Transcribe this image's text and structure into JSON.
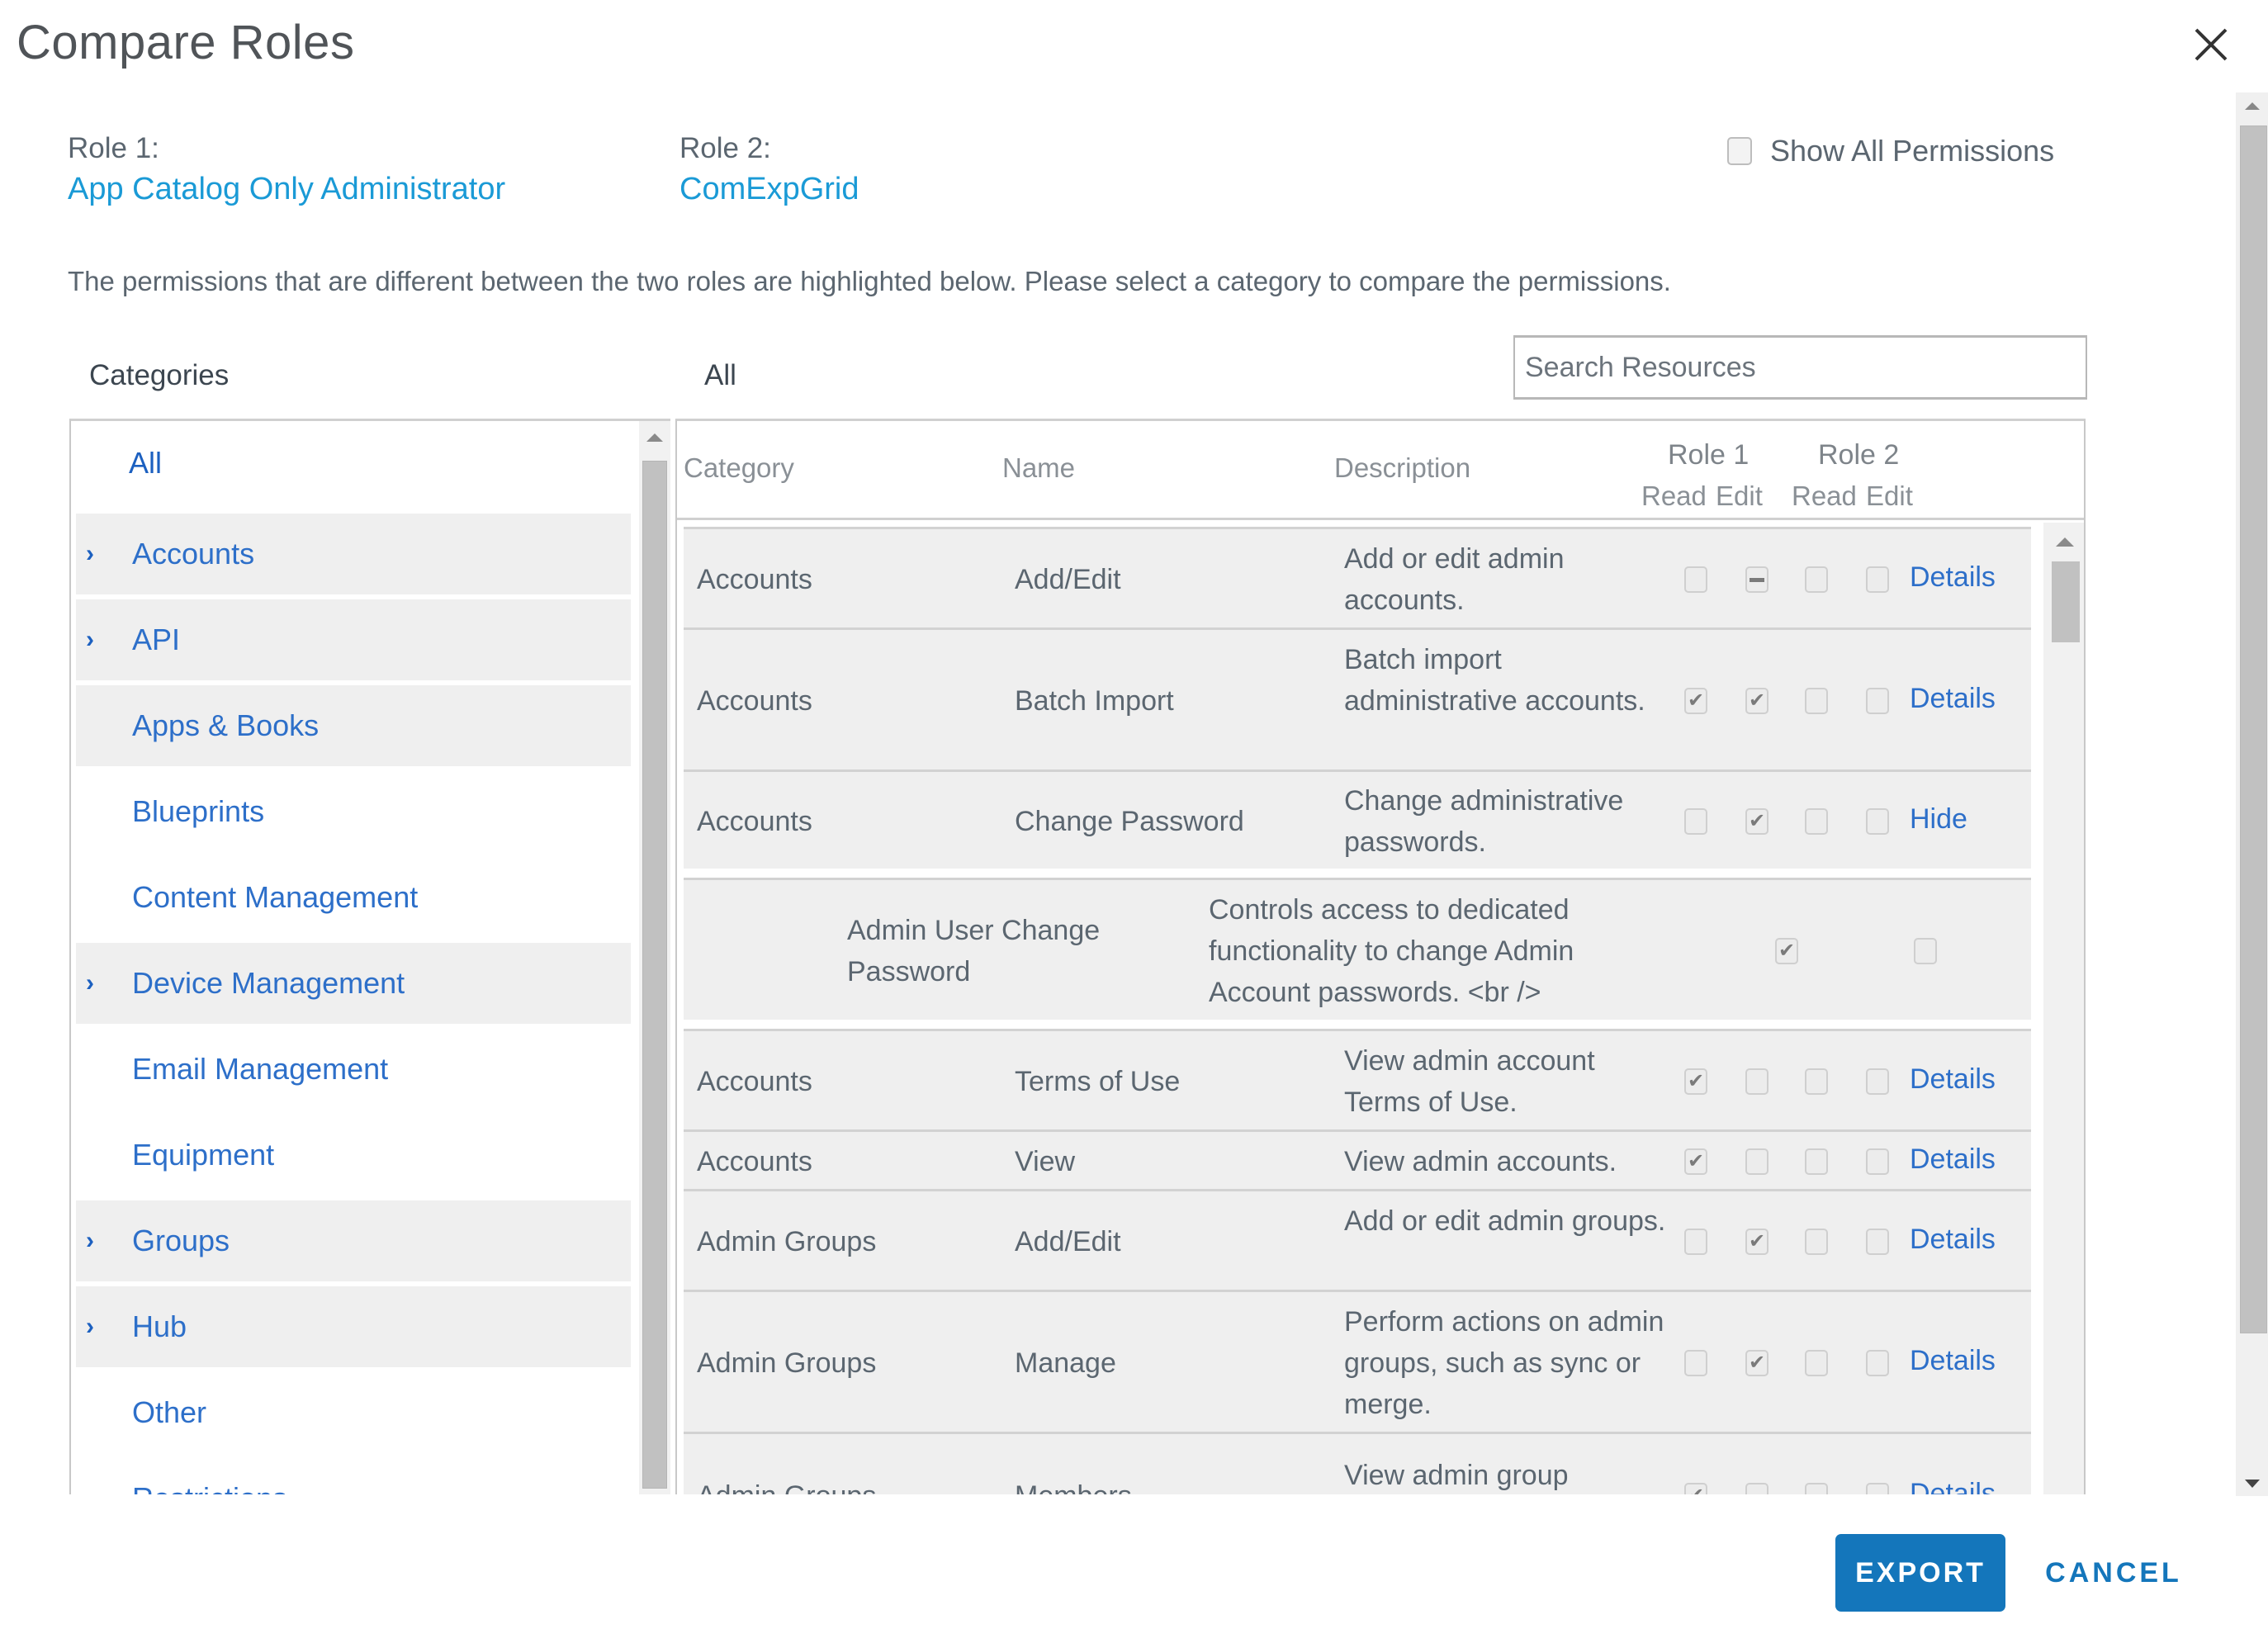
{
  "dialog": {
    "title": "Compare Roles",
    "close_icon": "close-icon"
  },
  "roles": {
    "role1_label": "Role 1:",
    "role1_name": "App Catalog Only Administrator",
    "role2_label": "Role 2:",
    "role2_name": "ComExpGrid"
  },
  "show_all": {
    "label": "Show All Permissions",
    "checked": false
  },
  "description": "The permissions that are different between the two roles are highlighted below. Please select a category to compare the permissions.",
  "categories_heading": "Categories",
  "selected_category_heading": "All",
  "search": {
    "placeholder": "Search Resources",
    "value": ""
  },
  "categories": [
    {
      "label": "All",
      "expandable": false,
      "shaded": false,
      "selected": true
    },
    {
      "label": "Accounts",
      "expandable": true,
      "shaded": true
    },
    {
      "label": "API",
      "expandable": true,
      "shaded": true
    },
    {
      "label": "Apps & Books",
      "expandable": false,
      "shaded": true
    },
    {
      "label": "Blueprints",
      "expandable": false,
      "shaded": false
    },
    {
      "label": "Content Management",
      "expandable": false,
      "shaded": false
    },
    {
      "label": "Device Management",
      "expandable": true,
      "shaded": true
    },
    {
      "label": "Email Management",
      "expandable": false,
      "shaded": false
    },
    {
      "label": "Equipment",
      "expandable": false,
      "shaded": false
    },
    {
      "label": "Groups",
      "expandable": true,
      "shaded": true
    },
    {
      "label": "Hub",
      "expandable": true,
      "shaded": true
    },
    {
      "label": "Other",
      "expandable": false,
      "shaded": false
    },
    {
      "label": "Restrictions",
      "expandable": true,
      "shaded": false
    }
  ],
  "table": {
    "headers": {
      "category": "Category",
      "name": "Name",
      "description": "Description",
      "role1": "Role 1",
      "role2": "Role 2",
      "read": "Read",
      "edit": "Edit"
    },
    "rows": [
      {
        "category": "Accounts",
        "name": "Add/Edit",
        "description": "Add or edit admin accounts.",
        "r1_read": "unchecked",
        "r1_edit": "indeterminate",
        "r2_read": "unchecked",
        "r2_edit": "unchecked",
        "link": "Details"
      },
      {
        "category": "Accounts",
        "name": "Batch Import",
        "description": "Batch import administrative accounts.",
        "r1_read": "checked",
        "r1_edit": "checked",
        "r2_read": "unchecked",
        "r2_edit": "unchecked",
        "link": "Details"
      },
      {
        "category": "Accounts",
        "name": "Change Password",
        "description": "Change administrative passwords.",
        "r1_read": "unchecked",
        "r1_edit": "checked",
        "r2_read": "unchecked",
        "r2_edit": "unchecked",
        "link": "Hide"
      },
      {
        "type": "detail",
        "name": "Admin User Change Password",
        "description": "Controls access to dedicated functionality to change Admin Account passwords. <br />",
        "role1": "checked",
        "role2": "unchecked"
      },
      {
        "category": "Accounts",
        "name": "Terms of Use",
        "description": "View admin account Terms of Use.",
        "r1_read": "checked",
        "r1_edit": "unchecked",
        "r2_read": "unchecked",
        "r2_edit": "unchecked",
        "link": "Details"
      },
      {
        "category": "Accounts",
        "name": "View",
        "description": "View admin accounts.",
        "r1_read": "checked",
        "r1_edit": "unchecked",
        "r2_read": "unchecked",
        "r2_edit": "unchecked",
        "link": "Details"
      },
      {
        "category": "Admin Groups",
        "name": "Add/Edit",
        "description": "Add or edit admin groups.",
        "r1_read": "unchecked",
        "r1_edit": "checked",
        "r2_read": "unchecked",
        "r2_edit": "unchecked",
        "link": "Details"
      },
      {
        "category": "Admin Groups",
        "name": "Manage",
        "description": "Perform actions on admin groups, such as sync or merge.",
        "r1_read": "unchecked",
        "r1_edit": "checked",
        "r2_read": "unchecked",
        "r2_edit": "unchecked",
        "link": "Details"
      },
      {
        "category": "Admin Groups",
        "name": "Members",
        "description": "View admin group members.",
        "r1_read": "checked",
        "r1_edit": "unchecked",
        "r2_read": "unchecked",
        "r2_edit": "unchecked",
        "link": "Details"
      }
    ]
  },
  "footer": {
    "export_label": "EXPORT",
    "cancel_label": "CANCEL"
  },
  "colors": {
    "link": "#1a9ad6",
    "category_link": "#2d6fc9",
    "primary_button": "#1476bb"
  }
}
